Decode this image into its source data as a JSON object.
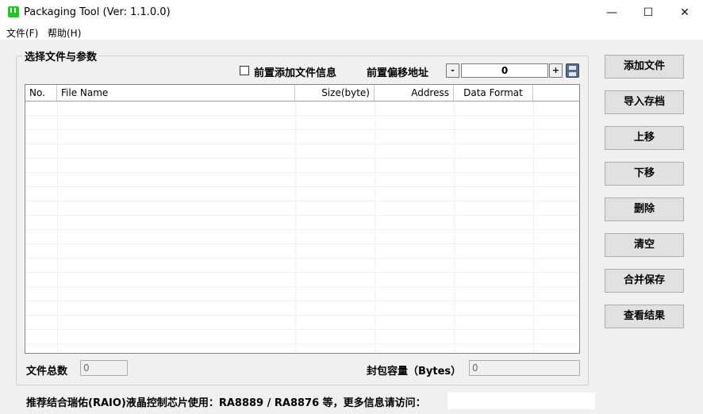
{
  "window": {
    "title": "Packaging Tool (Ver: 1.1.0.0)",
    "minimize": "—",
    "maximize": "☐",
    "close": "✕"
  },
  "menu": {
    "file": "文件(F)",
    "help": "帮助(H)"
  },
  "group": {
    "title": "选择文件与参数",
    "prepend_checkbox_label": "前置添加文件信息",
    "prepend_checked": false,
    "offset_label": "前置偏移地址",
    "offset_minus": "-",
    "offset_value": "0",
    "offset_plus": "+"
  },
  "table": {
    "columns": [
      "No.",
      "File Name",
      "Size(byte)",
      "Address",
      "Data Format"
    ],
    "rows": []
  },
  "buttons": {
    "add_file": "添加文件",
    "import_archive": "导入存档",
    "move_up": "上移",
    "move_down": "下移",
    "delete": "删除",
    "clear": "清空",
    "merge_save": "合并保存",
    "view_result": "查看结果"
  },
  "summary": {
    "file_count_label": "文件总数",
    "file_count_value": "0",
    "capacity_label": "封包容量（Bytes）",
    "capacity_value": "0"
  },
  "footer": {
    "text": "推荐结合瑞佑(RAIO)液晶控制芯片使用：RA8889 / RA8876 等，更多信息请访问："
  }
}
